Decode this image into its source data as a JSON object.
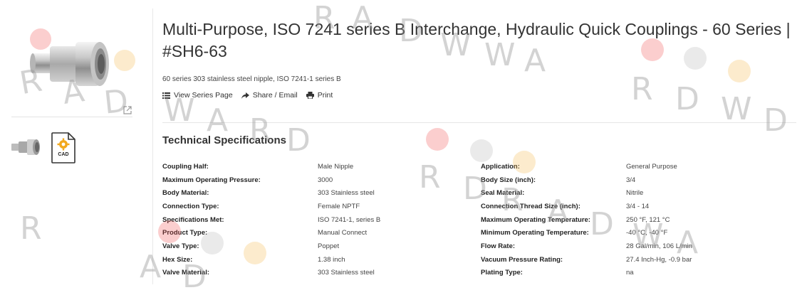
{
  "product": {
    "title": "Multi-Purpose, ISO 7241 series B Interchange, Hydraulic Quick Couplings - 60 Series | #SH6-63",
    "subtitle": "60 series 303 stainless steel nipple, ISO 7241-1 series B"
  },
  "actions": {
    "view_series": "View Series Page",
    "share": "Share / Email",
    "print": "Print"
  },
  "thumbnails": {
    "cad_label": "CAD"
  },
  "specs": {
    "heading": "Technical Specifications",
    "rows": [
      {
        "l1": "Coupling Half:",
        "v1": "Male Nipple",
        "l2": "Application:",
        "v2": "General Purpose"
      },
      {
        "l1": "Maximum Operating Pressure:",
        "v1": "3000",
        "l2": "Body Size (inch):",
        "v2": "3/4"
      },
      {
        "l1": "Body Material:",
        "v1": "303 Stainless steel",
        "l2": "Seal Material:",
        "v2": "Nitrile"
      },
      {
        "l1": "Connection Type:",
        "v1": "Female NPTF",
        "l2": "Connection Thread Size (inch):",
        "v2": "3/4 - 14"
      },
      {
        "l1": "Specifications Met:",
        "v1": "ISO 7241-1, series B",
        "l2": "Maximum Operating Temperature:",
        "v2": "250 °F, 121 °C"
      },
      {
        "l1": "Product Type:",
        "v1": "Manual Connect",
        "l2": "Minimum Operating Temperature:",
        "v2": "-40 °C, -40 °F"
      },
      {
        "l1": "Valve Type:",
        "v1": "Poppet",
        "l2": "Flow Rate:",
        "v2": "28 Gal/min, 106 L/min"
      },
      {
        "l1": "Hex Size:",
        "v1": "1.38 inch",
        "l2": "Vacuum Pressure Rating:",
        "v2": "27.4 Inch-Hg, -0.9 bar"
      },
      {
        "l1": "Valve Material:",
        "v1": "303 Stainless steel",
        "l2": "Plating Type:",
        "v2": "na"
      }
    ]
  },
  "watermark": {
    "letters": [
      "R",
      "A",
      "D",
      "W",
      "A",
      "R",
      "D",
      "R",
      "A",
      "D",
      "W",
      "W",
      "A",
      "R",
      "D",
      "R",
      "A",
      "D",
      "W",
      "A",
      "R",
      "D",
      "W",
      "D",
      "R",
      "A",
      "D"
    ]
  },
  "colors": {
    "accent_yellow": "#f2a81d",
    "watermark_red": "#f05050",
    "watermark_yellow": "#f5be5a"
  }
}
